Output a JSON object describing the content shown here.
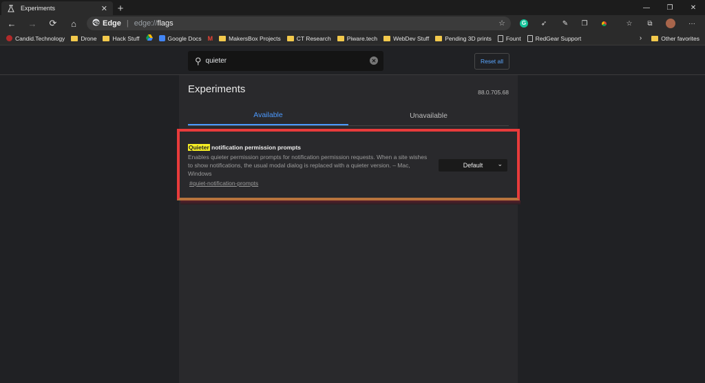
{
  "tab": {
    "title": "Experiments",
    "close": "✕"
  },
  "window": {
    "minimize": "—",
    "restore": "❐",
    "close": "✕"
  },
  "omnibox": {
    "brand": "Edge",
    "separator": "|",
    "url_scheme": "edge://",
    "url_path": "flags"
  },
  "bookmarks": [
    {
      "label": "Candid.Technology",
      "icon": "candid-favicon",
      "color": "#b22a2a"
    },
    {
      "label": "Drone",
      "icon": "folder"
    },
    {
      "label": "Hack Stuff",
      "icon": "folder"
    },
    {
      "label": "Google Docs",
      "icon": "docs-favicon",
      "color": "#4285f4"
    },
    {
      "label": "",
      "icon": "gmail-favicon",
      "color": "#ea4335"
    },
    {
      "label": "MakersBox Projects",
      "icon": "folder"
    },
    {
      "label": "CT Research",
      "icon": "folder"
    },
    {
      "label": "Piware.tech",
      "icon": "folder"
    },
    {
      "label": "WebDev Stuff",
      "icon": "folder"
    },
    {
      "label": "Pending 3D prints",
      "icon": "folder"
    },
    {
      "label": "Fount",
      "icon": "page"
    },
    {
      "label": "RedGear Support",
      "icon": "page"
    }
  ],
  "other_favorites": "Other favorites",
  "search": {
    "value": "quieter",
    "clear": "✕"
  },
  "reset_button": "Reset all",
  "page": {
    "title": "Experiments",
    "version": "88.0.705.68"
  },
  "tabs": [
    "Available",
    "Unavailable"
  ],
  "flag": {
    "title_highlight": "Quieter",
    "title_rest": " notification permission prompts",
    "description": "Enables quieter permission prompts for notification permission requests. When a site wishes to show notifications, the usual modal dialog is replaced with a quieter version. – Mac, Windows",
    "link": "#quiet-notification-prompts",
    "select_value": "Default"
  },
  "colors": {
    "accent": "#4c9aff",
    "highlight": "#f6ef24",
    "annotation_box": "#e83b3b"
  }
}
